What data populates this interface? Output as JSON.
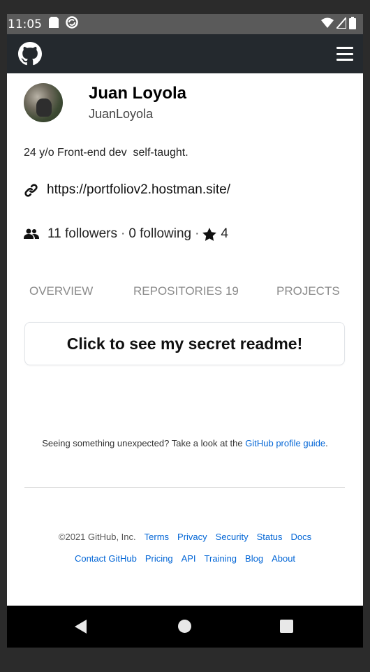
{
  "status_bar": {
    "time": "11:05"
  },
  "profile": {
    "full_name": "Juan Loyola",
    "username": "JuanLoyola",
    "bio": "24 y/o Front-end dev  self-taught.",
    "website": "https://portfoliov2.hostman.site/",
    "followers": "11 followers",
    "following": "0 following",
    "stars": "4",
    "separator": "·"
  },
  "tabs": [
    {
      "label": "OVERVIEW"
    },
    {
      "label": "REPOSITORIES 19"
    },
    {
      "label": "PROJECTS"
    }
  ],
  "readme_button": "Click to see my secret readme!",
  "guide": {
    "text": "Seeing something unexpected? Take a look at the ",
    "link": "GitHub profile guide",
    "end": "."
  },
  "footer": {
    "copyright": "©2021 GitHub, Inc.",
    "links_row1": [
      "Terms",
      "Privacy",
      "Security",
      "Status",
      "Docs"
    ],
    "links_row2": [
      "Contact GitHub",
      "Pricing",
      "API",
      "Training",
      "Blog",
      "About"
    ]
  },
  "icons": {
    "status": [
      "sim-card-icon",
      "sync-icon",
      "wifi-icon",
      "signal-icon",
      "battery-icon"
    ],
    "header": [
      "github-logo-icon",
      "hamburger-menu-icon"
    ],
    "profile": [
      "link-icon",
      "people-icon",
      "star-icon"
    ],
    "nav": [
      "back-icon",
      "home-icon",
      "recents-icon"
    ]
  },
  "colors": {
    "header_bg": "#24292e",
    "status_bg": "#5a5a5a",
    "link": "#0366d6",
    "tab_inactive": "#8a8a8a"
  }
}
